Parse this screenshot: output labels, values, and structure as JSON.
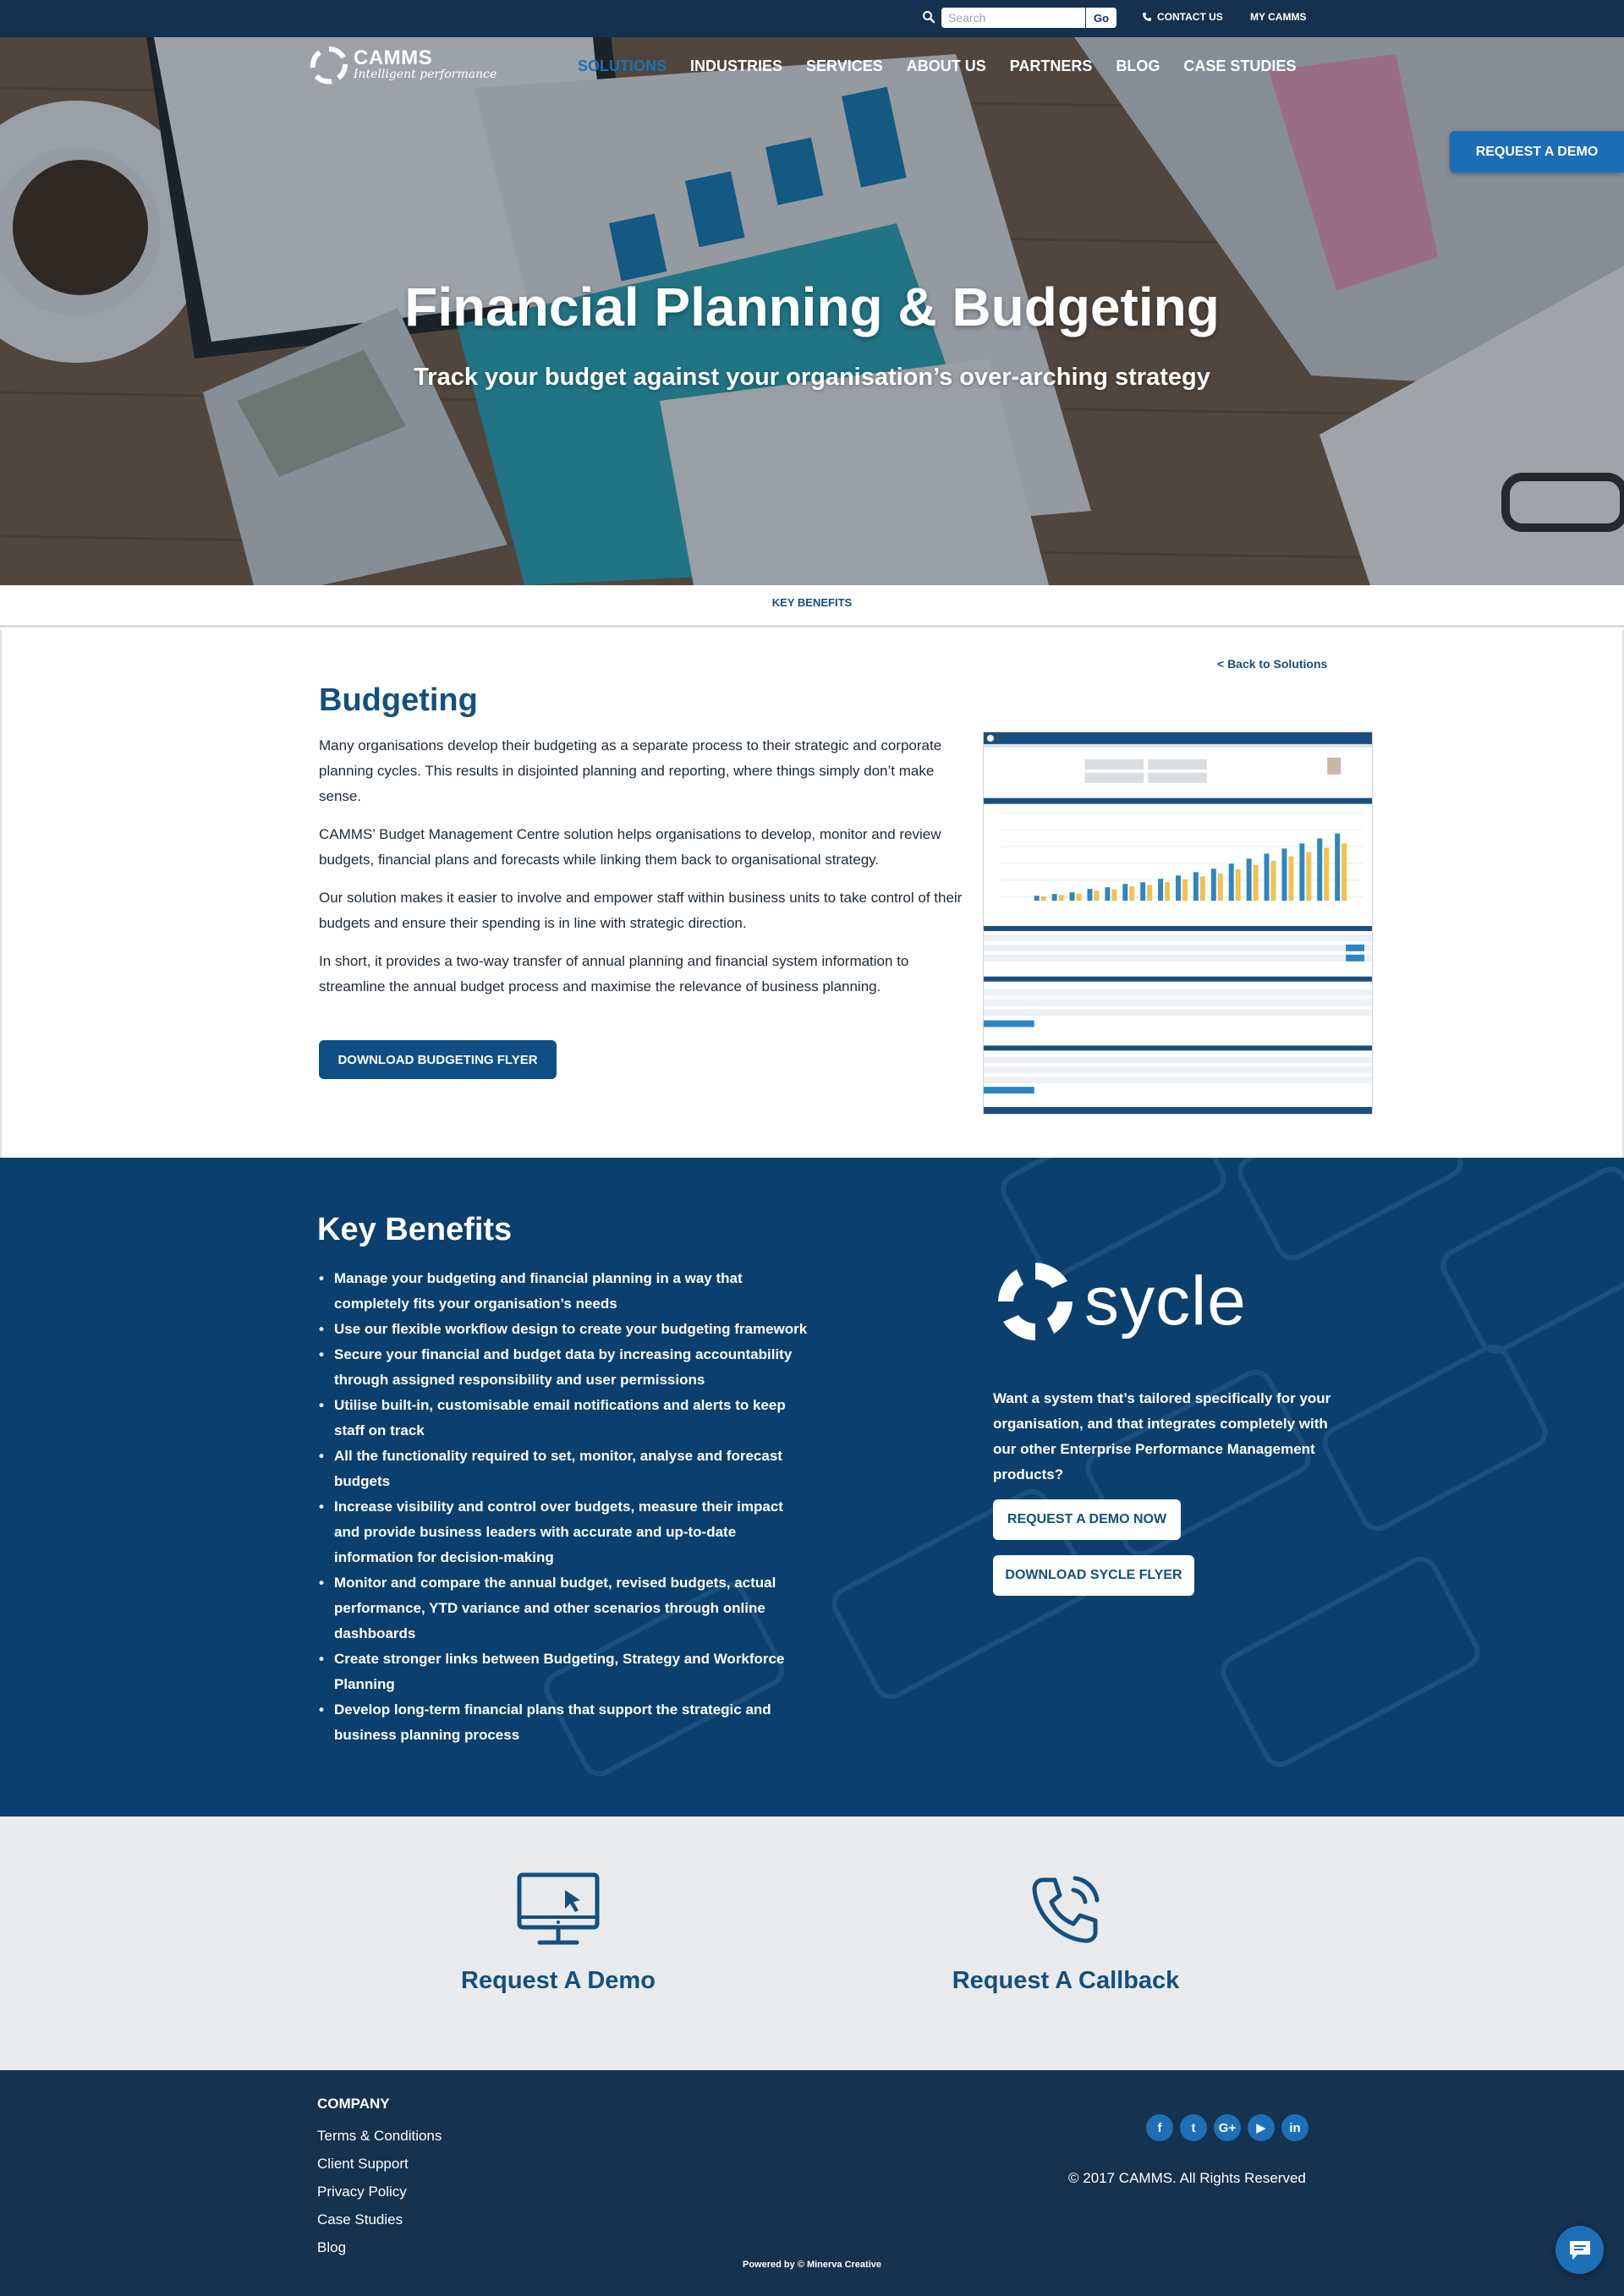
{
  "topbar": {
    "search_placeholder": "Search",
    "go_label": "Go",
    "contact_label": "CONTACT US",
    "mycamms_label": "MY CAMMS"
  },
  "logo": {
    "name": "CAMMS",
    "tagline": "Intelligent performance"
  },
  "nav": {
    "items": [
      {
        "label": "SOLUTIONS",
        "active": true
      },
      {
        "label": "INDUSTRIES",
        "active": false
      },
      {
        "label": "SERVICES",
        "active": false
      },
      {
        "label": "ABOUT US",
        "active": false
      },
      {
        "label": "PARTNERS",
        "active": false
      },
      {
        "label": "BLOG",
        "active": false
      },
      {
        "label": "CASE STUDIES",
        "active": false
      }
    ]
  },
  "hero": {
    "title": "Financial Planning & Budgeting",
    "subtitle": "Track your budget against your organisation’s over-arching strategy",
    "demo_tab": "REQUEST A DEMO"
  },
  "anchor": {
    "key_benefits": "KEY BENEFITS"
  },
  "budgeting": {
    "back_link": "< Back to Solutions",
    "title": "Budgeting",
    "paragraphs": [
      "Many organisations develop their budgeting as a separate process to their strategic and corporate planning cycles. This results in disjointed planning and reporting, where things simply don’t make sense.",
      "CAMMS’ Budget Management Centre solution helps organisations to develop, monitor and review budgets, financial plans and forecasts while linking them back to organisational strategy.",
      "Our solution makes it easier to involve and empower staff within business units to take control of their budgets and ensure their spending is in line with strategic direction.",
      "In short, it provides a two-way transfer of annual planning and financial system information to streamline the annual budget process and maximise the relevance of business planning."
    ],
    "download_label": "DOWNLOAD BUDGETING FLYER"
  },
  "benefits": {
    "title": "Key Benefits",
    "items": [
      "Manage your budgeting and financial planning in a way that completely fits your organisation’s needs",
      "Use our flexible workflow design to create your budgeting framework",
      "Secure your financial and budget data by increasing accountability through assigned responsibility and user permissions",
      "Utilise built-in, customisable email notifications and alerts to keep staff on track",
      "All the functionality required to set, monitor, analyse and forecast budgets",
      "Increase visibility and control over budgets, measure their impact and provide business leaders with accurate and up-to-date information for decision-making",
      "Monitor and compare the annual budget, revised budgets, actual performance, YTD variance and other scenarios through online dashboards",
      "Create stronger links between Budgeting, Strategy and Workforce Planning",
      "Develop long-term financial plans that support the strategic and business planning process"
    ],
    "sycle_word": "sycle",
    "sycle_text": "Want a system that’s tailored specifically for your organisation, and that integrates completely with our other Enterprise Performance Management products?",
    "demo_now_label": "REQUEST A DEMO NOW",
    "sycle_flyer_label": "DOWNLOAD SYCLE FLYER"
  },
  "cta": {
    "demo_label": "Request A Demo",
    "callback_label": "Request A Callback"
  },
  "footer": {
    "heading": "COMPANY",
    "links": [
      "Terms & Conditions",
      "Client Support",
      "Privacy Policy",
      "Case Studies",
      "Blog"
    ],
    "social": [
      {
        "icon": "facebook-icon",
        "glyph": "f"
      },
      {
        "icon": "twitter-icon",
        "glyph": "t"
      },
      {
        "icon": "google-plus-icon",
        "glyph": "G+"
      },
      {
        "icon": "youtube-icon",
        "glyph": "▶"
      },
      {
        "icon": "linkedin-icon",
        "glyph": "in"
      }
    ],
    "copyright": "© 2017 CAMMS. All Rights Reserved",
    "powered": "Powered by © Minerva Creative"
  },
  "colors": {
    "navy": "#14324f",
    "brand_blue": "#14507f",
    "accent_blue": "#1b6db6",
    "benefits_bg": "#0b3f6d",
    "cta_bg": "#e9eaeb"
  }
}
